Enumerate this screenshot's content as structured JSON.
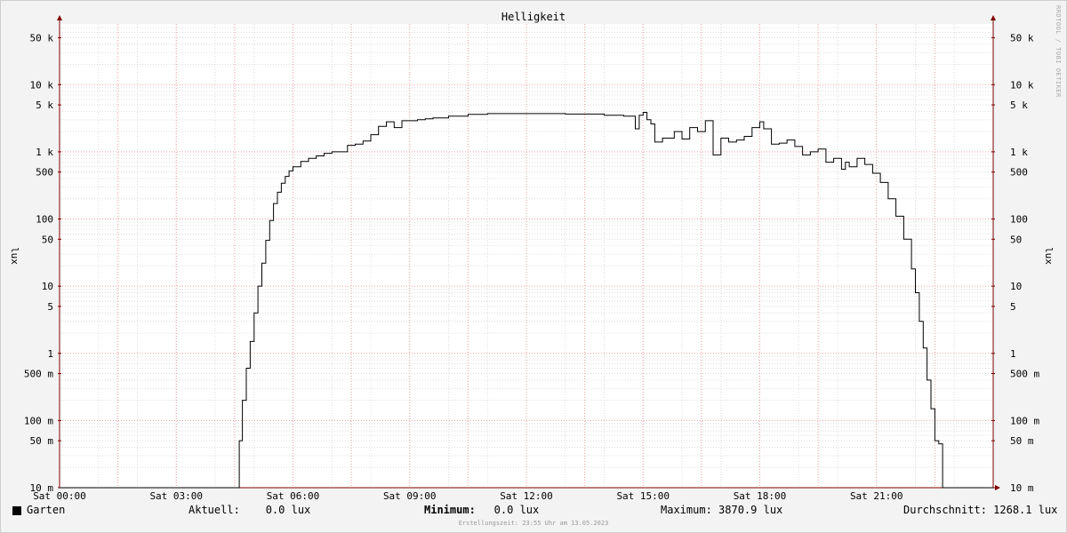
{
  "chart_data": {
    "type": "line",
    "title": "Helligkeit",
    "ylabel": "lux",
    "yscale": "log",
    "ylim": [
      0.01,
      80000
    ],
    "xlim": [
      0,
      24
    ],
    "grid": true,
    "x_ticks": [
      {
        "x": 0,
        "label": "Sat 00:00"
      },
      {
        "x": 3,
        "label": "Sat 03:00"
      },
      {
        "x": 6,
        "label": "Sat 06:00"
      },
      {
        "x": 9,
        "label": "Sat 09:00"
      },
      {
        "x": 12,
        "label": "Sat 12:00"
      },
      {
        "x": 15,
        "label": "Sat 15:00"
      },
      {
        "x": 18,
        "label": "Sat 18:00"
      },
      {
        "x": 21,
        "label": "Sat 21:00"
      }
    ],
    "y_ticks": [
      {
        "v": 50000,
        "label": "50 k"
      },
      {
        "v": 10000,
        "label": "10 k"
      },
      {
        "v": 5000,
        "label": "5 k"
      },
      {
        "v": 1000,
        "label": "1 k"
      },
      {
        "v": 500,
        "label": "500"
      },
      {
        "v": 100,
        "label": "100"
      },
      {
        "v": 50,
        "label": "50"
      },
      {
        "v": 10,
        "label": "10"
      },
      {
        "v": 5,
        "label": "5"
      },
      {
        "v": 1,
        "label": "1"
      },
      {
        "v": 0.5,
        "label": "500 m"
      },
      {
        "v": 0.1,
        "label": "100 m"
      },
      {
        "v": 0.05,
        "label": "50 m"
      },
      {
        "v": 0.01,
        "label": "10 m"
      }
    ],
    "series": [
      {
        "name": "Garten",
        "color": "#000000",
        "x": [
          0,
          4.6,
          4.62,
          4.7,
          4.8,
          4.9,
          5.0,
          5.1,
          5.2,
          5.3,
          5.4,
          5.5,
          5.6,
          5.7,
          5.8,
          5.9,
          6.0,
          6.2,
          6.4,
          6.6,
          6.8,
          7.0,
          7.4,
          7.6,
          7.8,
          8.0,
          8.2,
          8.4,
          8.6,
          8.8,
          9.0,
          9.2,
          9.4,
          9.6,
          10.0,
          10.5,
          11.0,
          12.0,
          13.0,
          14.0,
          14.5,
          14.8,
          14.9,
          15.0,
          15.1,
          15.2,
          15.3,
          15.5,
          15.8,
          16.0,
          16.2,
          16.4,
          16.6,
          16.8,
          17.0,
          17.2,
          17.4,
          17.6,
          17.8,
          18.0,
          18.1,
          18.3,
          18.5,
          18.7,
          18.9,
          19.1,
          19.3,
          19.5,
          19.7,
          19.9,
          20.1,
          20.2,
          20.3,
          20.5,
          20.7,
          20.9,
          21.1,
          21.3,
          21.5,
          21.7,
          21.9,
          22.0,
          22.1,
          22.2,
          22.3,
          22.4,
          22.5,
          22.6,
          22.7,
          22.8,
          22.9,
          22.98,
          24
        ],
        "y": [
          0.01,
          0.01,
          0.05,
          0.2,
          0.6,
          1.5,
          4,
          10,
          22,
          48,
          95,
          170,
          250,
          340,
          430,
          520,
          600,
          720,
          800,
          870,
          950,
          1000,
          1250,
          1300,
          1450,
          1800,
          2400,
          2800,
          2300,
          2900,
          2900,
          3000,
          3100,
          3200,
          3400,
          3600,
          3700,
          3700,
          3650,
          3500,
          3400,
          2200,
          3500,
          3870,
          3000,
          2600,
          1400,
          1600,
          2000,
          1550,
          2300,
          2000,
          2900,
          900,
          1600,
          1400,
          1500,
          1700,
          2300,
          2800,
          2200,
          1300,
          1350,
          1500,
          1200,
          900,
          1000,
          1100,
          700,
          800,
          550,
          700,
          600,
          800,
          650,
          480,
          350,
          200,
          110,
          50,
          18,
          8,
          3,
          1.2,
          0.4,
          0.15,
          0.05,
          0.045,
          0.01,
          0.01,
          0.01,
          0.01,
          0.01
        ]
      }
    ],
    "legend": {
      "series_label": "Garten",
      "current": "Aktuell:    0.0 lux",
      "minimum_label": "Minimum:",
      "minimum_value": "   0.0 lux",
      "maximum": "Maximum: 3870.9 lux",
      "average": "Durchschnitt: 1268.1 lux"
    },
    "footer": "Erstellungszeit: 23:55 Uhr am 13.05.2023",
    "watermark": "RRDTOOL / TOBI OETIKER"
  },
  "colors": {
    "plot_bg": "#ffffff",
    "grid_minor": "#dcdcdc",
    "grid_major": "#f0a0a0",
    "axis": "#7f0000",
    "line": "#000000"
  }
}
